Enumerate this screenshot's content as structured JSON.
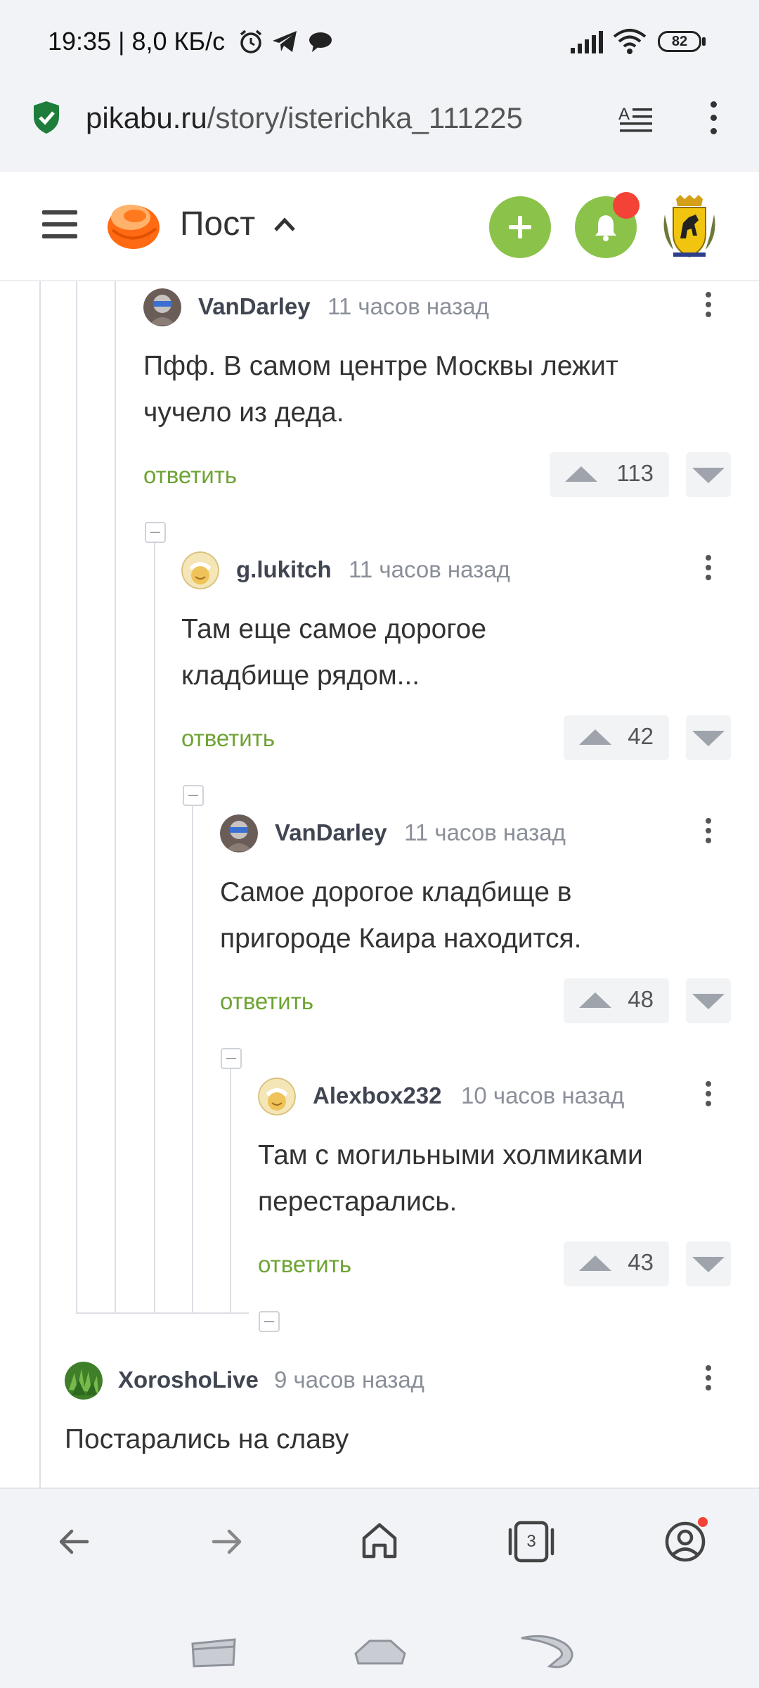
{
  "status_bar": {
    "time_text": "19:35 | 8,0 КБ/с",
    "battery_level": "82"
  },
  "url_bar": {
    "domain": "pikabu.ru",
    "path": "/story/isterichka_111225"
  },
  "header": {
    "title": "Пост"
  },
  "tabs_count": "3",
  "comments": [
    {
      "user": "VanDarley",
      "time": "11 часов назад",
      "text": "Пфф. В самом центре Москвы лежит чучело из деда.",
      "reply": "ответить",
      "rating": "113"
    },
    {
      "user": "g.lukitch",
      "time": "11 часов назад",
      "text": "Там еще самое дорогое кладбище рядом...",
      "reply": "ответить",
      "rating": "42"
    },
    {
      "user": "VanDarley",
      "time": "11 часов назад",
      "text": "Самое дорогое кладбище в пригороде Каира находится.",
      "reply": "ответить",
      "rating": "48"
    },
    {
      "user": "Alexbox232",
      "time": "10 часов назад",
      "text": "Там с могильными холмиками перестарались.",
      "reply": "ответить",
      "rating": "43"
    },
    {
      "user": "XoroshoLive",
      "time": "9 часов назад",
      "text": "Постарались на славу"
    }
  ],
  "colors": {
    "accent_green": "#8bc34a",
    "reply_green": "#6ea334",
    "notification_red": "#f44336"
  },
  "icons": [
    "shield-check-icon",
    "reader-mode-icon",
    "menu-icon",
    "pikabu-logo",
    "plus-icon",
    "bell-icon",
    "coat-of-arms-avatar",
    "back-icon",
    "forward-icon",
    "home-icon",
    "tabs-icon",
    "account-icon"
  ]
}
